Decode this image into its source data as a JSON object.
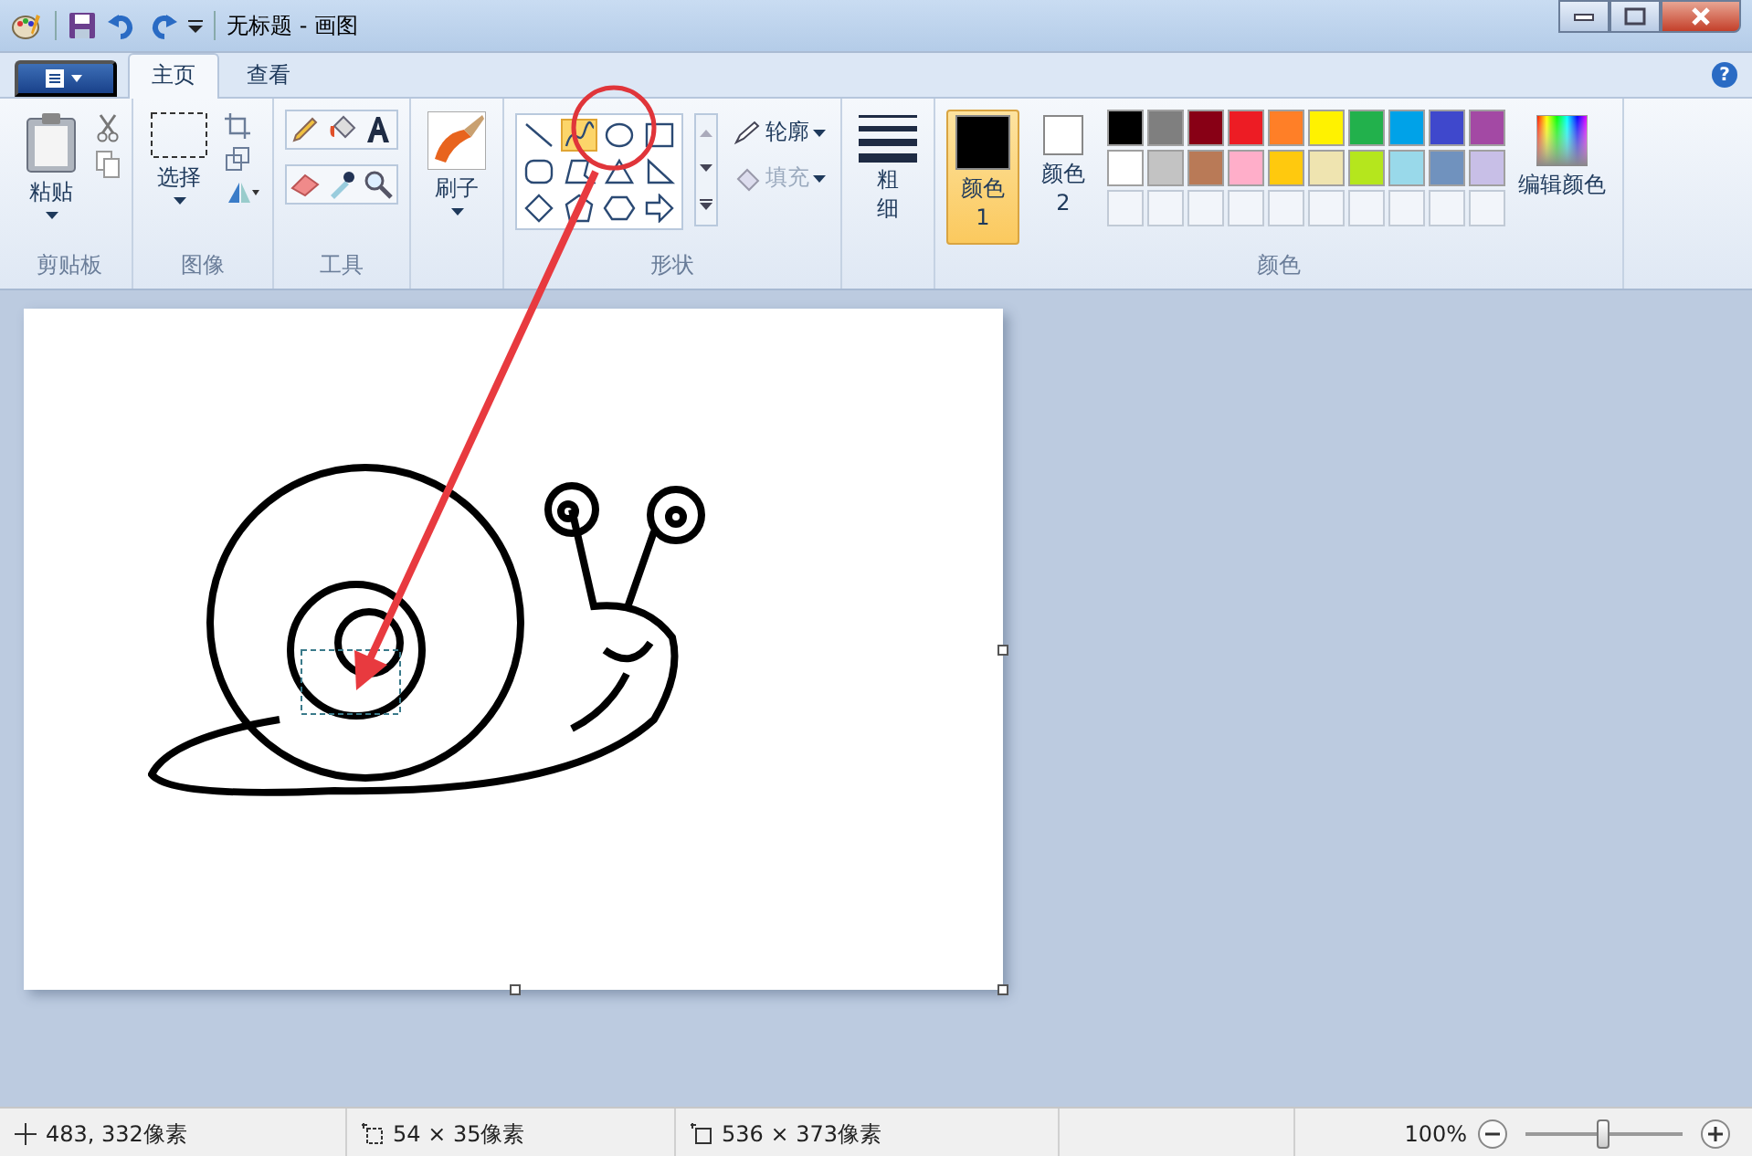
{
  "title_bar": {
    "title": "无标题 - 画图"
  },
  "help": "?",
  "tabs": [
    {
      "label": "主页",
      "selected": true
    },
    {
      "label": "查看",
      "selected": false
    }
  ],
  "ribbon": {
    "clipboard": {
      "label": "剪贴板",
      "paste": "粘贴"
    },
    "image": {
      "label": "图像",
      "select": "选择"
    },
    "tools": {
      "label": "工具"
    },
    "brushes": {
      "label": "刷子"
    },
    "shapes": {
      "label": "形状",
      "outline": "轮廓",
      "fill": "填充",
      "items": [
        {
          "kind": "line",
          "selected": false
        },
        {
          "kind": "curve",
          "selected": true
        },
        {
          "kind": "oval",
          "selected": false
        },
        {
          "kind": "rectangle",
          "selected": false
        },
        {
          "kind": "rounded-rectangle",
          "selected": false
        },
        {
          "kind": "polygon",
          "selected": false
        },
        {
          "kind": "triangle",
          "selected": false
        },
        {
          "kind": "right-triangle",
          "selected": false
        },
        {
          "kind": "diamond",
          "selected": false
        },
        {
          "kind": "pentagon",
          "selected": false
        },
        {
          "kind": "hexagon",
          "selected": false
        },
        {
          "kind": "arrow",
          "selected": false
        }
      ]
    },
    "size": {
      "label": "粗细"
    },
    "colors": {
      "label": "颜色",
      "edit": "编辑颜色",
      "slots": [
        {
          "label": "颜色 1",
          "color": "#000000",
          "selected": true
        },
        {
          "label": "颜色 2",
          "color": "#ffffff",
          "selected": false
        }
      ],
      "palette": [
        {
          "color": "#000000"
        },
        {
          "color": "#7f7f7f"
        },
        {
          "color": "#880015"
        },
        {
          "color": "#ed1c24"
        },
        {
          "color": "#ff7f27"
        },
        {
          "color": "#fff200"
        },
        {
          "color": "#22b14c"
        },
        {
          "color": "#00a2e8"
        },
        {
          "color": "#3f48cc"
        },
        {
          "color": "#a349a4"
        },
        {
          "color": "#ffffff"
        },
        {
          "color": "#c3c3c3"
        },
        {
          "color": "#b97a57"
        },
        {
          "color": "#ffaec9"
        },
        {
          "color": "#ffc90e"
        },
        {
          "color": "#efe4b0"
        },
        {
          "color": "#b5e61d"
        },
        {
          "color": "#99d9ea"
        },
        {
          "color": "#7092be"
        },
        {
          "color": "#c8bfe7"
        }
      ]
    }
  },
  "status_bar": {
    "position": "483, 332像素",
    "selection": "54 × 35像素",
    "image_size": "536 × 373像素",
    "zoom": "100%",
    "zoom_slider": {
      "level": 0.5
    }
  }
}
